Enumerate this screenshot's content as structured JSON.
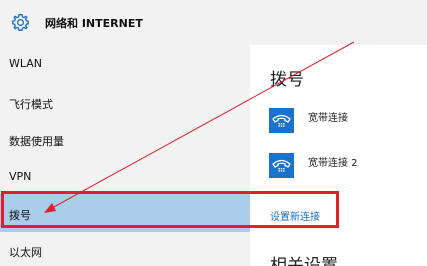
{
  "header": {
    "title": "网络和 INTERNET",
    "icon": "gear-icon"
  },
  "sidebar": {
    "items": [
      {
        "label": "WLAN",
        "selected": false
      },
      {
        "label": "飞行模式",
        "selected": false
      },
      {
        "label": "数据使用量",
        "selected": false
      },
      {
        "label": "VPN",
        "selected": false
      },
      {
        "label": "拨号",
        "selected": true
      },
      {
        "label": "以太网",
        "selected": false
      }
    ]
  },
  "main": {
    "section_title": "拨号",
    "connections": [
      {
        "label": "宽带连接",
        "icon": "dialup-phone-icon"
      },
      {
        "label": "宽带连接 2",
        "icon": "dialup-phone-icon"
      }
    ],
    "setup_link": "设置新连接",
    "related_title": "相关设置"
  },
  "colors": {
    "accent": "#1a73c8",
    "selected_bg": "#a9cdeb",
    "highlight": "#e0202c",
    "sidebar_bg": "#f2f2f2"
  }
}
